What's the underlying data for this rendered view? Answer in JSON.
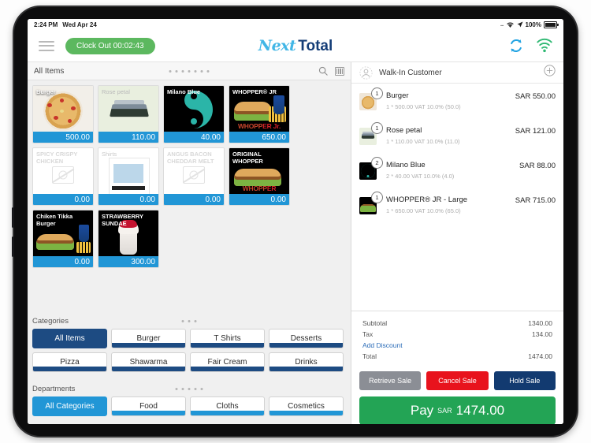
{
  "status_bar": {
    "time": "2:24 PM",
    "date": "Wed Apr 24",
    "dots": "....",
    "battery": "100%",
    "wifi_icon": "wifi-icon",
    "location_icon": "location-arrow-icon"
  },
  "appbar": {
    "menu_icon": "hamburger-menu-icon",
    "clock_out": "Clock Out 00:02:43",
    "brand_first": "Next",
    "brand_second": "Total",
    "sync_icon": "sync-icon",
    "wifi_icon": "wifi-signal-icon"
  },
  "items_panel": {
    "title": "All Items",
    "page_dots": 7,
    "search_icon": "search-icon",
    "barcode_icon": "barcode-icon",
    "products": [
      {
        "name": "Burger",
        "price": "500.00",
        "art": "pizza",
        "name_color": "#ffffff"
      },
      {
        "name": "Rose petal",
        "price": "110.00",
        "art": "rose",
        "name_color": "#b9b9b9"
      },
      {
        "name": "Milano Blue",
        "price": "40.00",
        "art": "yin",
        "name_color": "#ffffff"
      },
      {
        "name": "WHOPPER® JR",
        "price": "650.00",
        "art": "whopperjr",
        "name_color": "#ffffff"
      },
      {
        "name": "SPICY CRISPY CHICKEN",
        "price": "0.00",
        "art": "none",
        "name_color": "#d8d8d8"
      },
      {
        "name": "Shirts",
        "price": "0.00",
        "art": "shirt",
        "name_color": "#c9c9c9"
      },
      {
        "name": "ANGUS BACON CHEDDAR MELT",
        "price": "0.00",
        "art": "none",
        "name_color": "#d8d8d8"
      },
      {
        "name": "ORIGINAL WHOPPER",
        "price": "0.00",
        "art": "whopper",
        "name_color": "#ffffff"
      },
      {
        "name": "Chiken Tikka Burger",
        "price": "0.00",
        "art": "tikka",
        "name_color": "#ffffff"
      },
      {
        "name": "STRAWBERRY SUNDAE",
        "price": "300.00",
        "art": "sundae",
        "name_color": "#ffffff"
      }
    ]
  },
  "categories": {
    "label": "Categories",
    "page_dots": 3,
    "items": [
      {
        "label": "All Items",
        "active": true
      },
      {
        "label": "Burger",
        "active": false
      },
      {
        "label": "T Shirts",
        "active": false
      },
      {
        "label": "Desserts",
        "active": false
      },
      {
        "label": "Pizza",
        "active": false
      },
      {
        "label": "Shawarma",
        "active": false
      },
      {
        "label": "Fair Cream",
        "active": false
      },
      {
        "label": "Drinks",
        "active": false
      }
    ]
  },
  "departments": {
    "label": "Departments",
    "page_dots": 5,
    "items": [
      {
        "label": "All Categories",
        "active": true
      },
      {
        "label": "Food",
        "active": false
      },
      {
        "label": "Cloths",
        "active": false
      },
      {
        "label": "Cosmetics",
        "active": false
      }
    ]
  },
  "customer": {
    "avatar_icon": "user-avatar-icon",
    "name": "Walk-In Customer",
    "add_icon": "plus-circle-icon"
  },
  "cart": {
    "items": [
      {
        "qty": "1",
        "name": "Burger",
        "detail": "1 * 500.00 VAT 10.0% (50.0)",
        "amount": "SAR 550.00",
        "art": "pizza"
      },
      {
        "qty": "1",
        "name": "Rose petal",
        "detail": "1 * 110.00 VAT 10.0% (11.0)",
        "amount": "SAR 121.00",
        "art": "rose"
      },
      {
        "qty": "2",
        "name": "Milano Blue",
        "detail": "2 * 40.00 VAT 10.0% (4.0)",
        "amount": "SAR 88.00",
        "art": "yin"
      },
      {
        "qty": "1",
        "name": "WHOPPER® JR - Large",
        "detail": "1 * 650.00 VAT 10.0% (65.0)",
        "amount": "SAR 715.00",
        "art": "whopperjr"
      }
    ]
  },
  "totals": {
    "subtotal_label": "Subtotal",
    "subtotal_value": "1340.00",
    "tax_label": "Tax",
    "tax_value": "134.00",
    "discount_label": "Add Discount",
    "total_label": "Total",
    "total_value": "1474.00"
  },
  "actions": {
    "retrieve": "Retrieve Sale",
    "cancel": "Cancel Sale",
    "hold": "Hold Sale",
    "pay_word": "Pay",
    "pay_currency": "SAR",
    "pay_amount": "1474.00"
  },
  "colors": {
    "accent_blue": "#2196d6",
    "navy": "#1d4b82",
    "green": "#23a455",
    "red": "#e8131d",
    "grey": "#8b8e95",
    "clock_green": "#5cb85f"
  }
}
